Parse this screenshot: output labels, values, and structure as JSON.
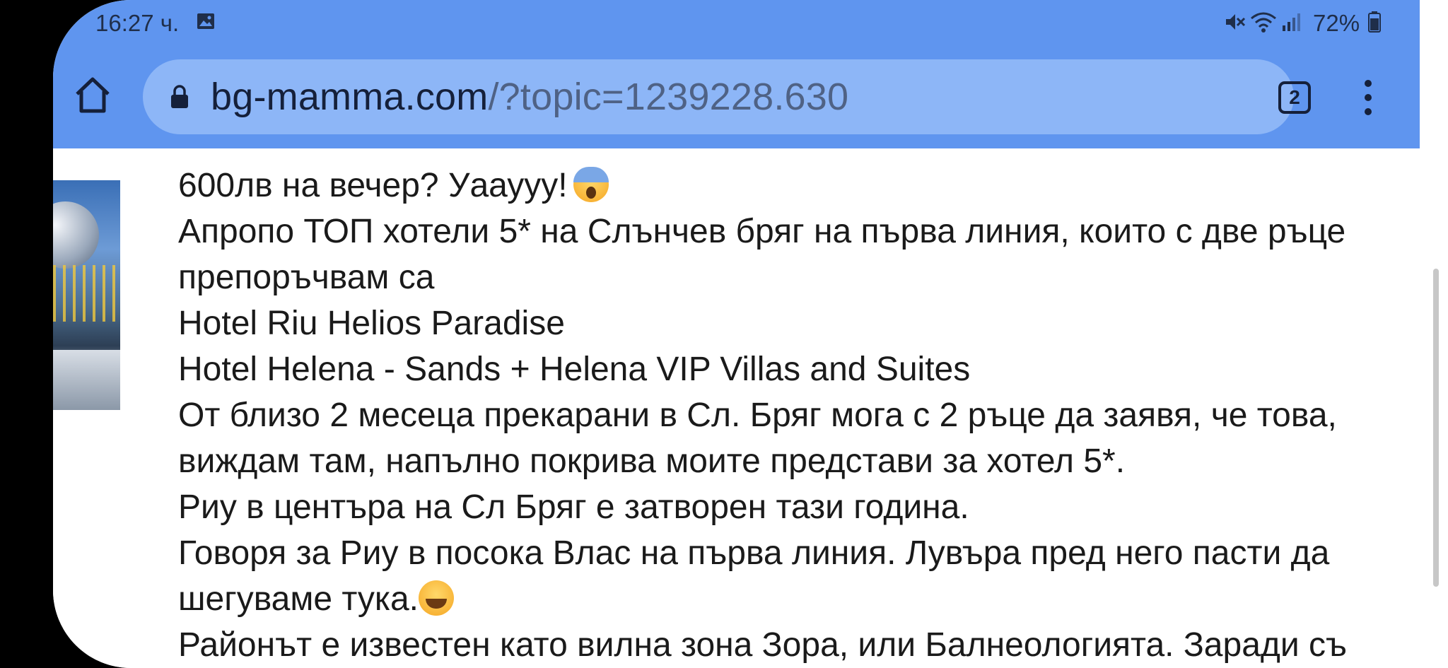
{
  "status_bar": {
    "time": "16:27 ч.",
    "icons": [
      "gallery-icon",
      "mute-icon",
      "wifi-icon",
      "signal-icon",
      "battery-icon"
    ],
    "battery": "72%"
  },
  "browser": {
    "url_host": "bg-mamma.com",
    "url_path": "/?topic=1239228.630",
    "tab_count": "2",
    "toolbar_color": "#5f95ef",
    "omnibox_color": "#8db6f7"
  },
  "post": {
    "lines": [
      "600лв на вечер? Уааууу!",
      "Апропо ТОП хотели 5* на Слънчев бряг на първа линия, които с две ръце",
      "препоръчвам са",
      "Hotel Riu Helios Paradise",
      "Hotel Helena - Sands + Helena VIP Villas and Suites",
      "От близо 2 месеца прекарани в Сл. Бряг мога с 2 ръце да заявя, че това,",
      "виждам там, напълно покрива моите представи за хотел 5*.",
      "Риу в центъра на Сл Бряг е затворен тази година.",
      "Говоря за Риу в посока Влас на първа линия. Лувъра пред него пасти да",
      "шегуваме тука.",
      "Районът е известен като вилна зона Зора, или Балнеологията. Заради съ"
    ],
    "emojis": [
      "face-screaming-in-fear",
      "grinning-squinting-face"
    ]
  }
}
